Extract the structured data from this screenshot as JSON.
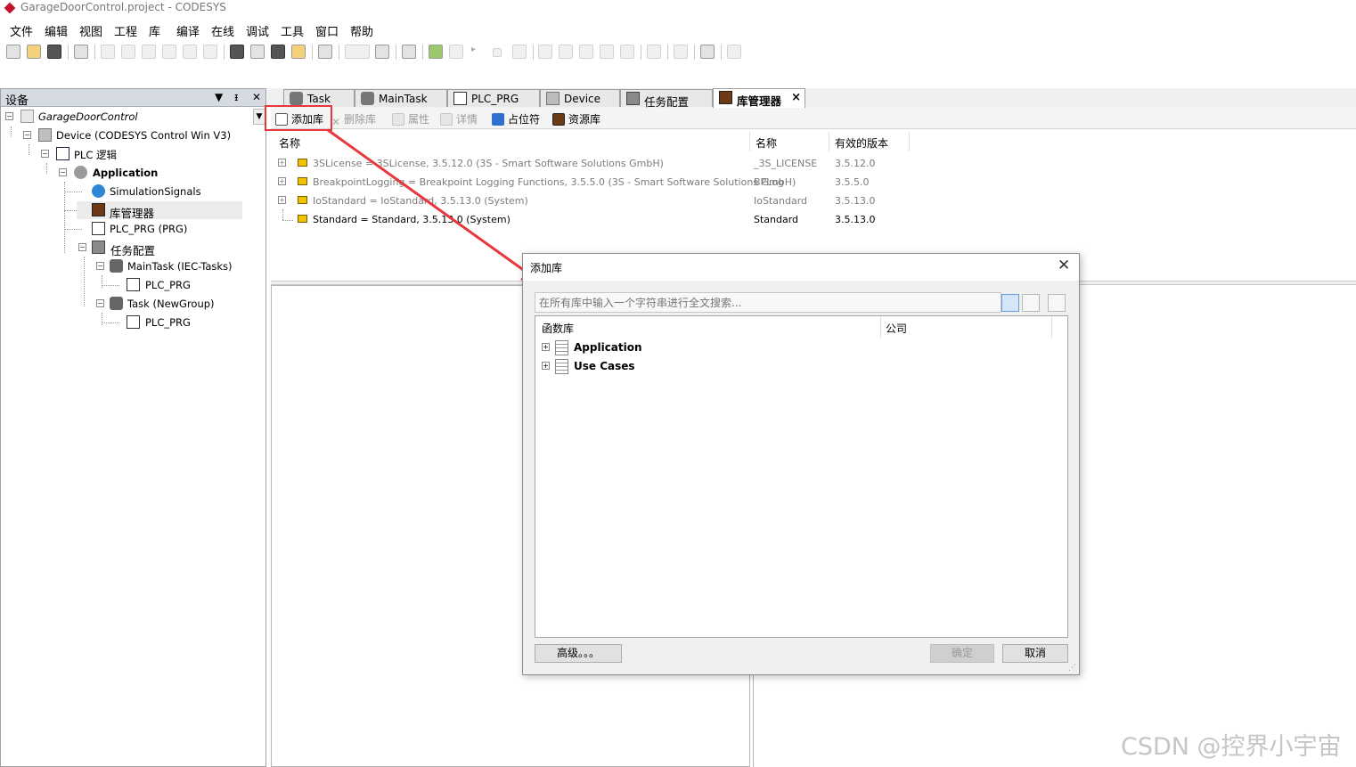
{
  "window": {
    "title": "GarageDoorControl.project - CODESYS"
  },
  "menu": [
    "文件",
    "编辑",
    "视图",
    "工程",
    "库",
    "编译",
    "在线",
    "调试",
    "工具",
    "窗口",
    "帮助"
  ],
  "toolbar_icons": [
    "new-file-icon",
    "open-icon",
    "save-icon",
    "print-icon",
    "undo-icon",
    "redo-icon",
    "cut-icon",
    "copy-icon",
    "paste-icon",
    "delete-icon",
    "find-icon",
    "find-replace-icon",
    "find-next-icon",
    "bookmark-icon",
    "window-icon",
    "dropdown-icon",
    "page-icon",
    "grid-icon",
    "build-icon",
    "build-all-icon",
    "run-icon",
    "stop-icon",
    "reset-icon",
    "step-into-icon",
    "step-over-icon",
    "step-out-icon",
    "breakpoint-icon",
    "gear-step-icon",
    "arrow-icon",
    "display-icon",
    "filter-icon",
    "check-icon"
  ],
  "devices_panel": {
    "title": "设备",
    "tree": [
      {
        "label": "GarageDoorControl",
        "italic": true
      },
      {
        "label": "Device (CODESYS Control Win V3)"
      },
      {
        "label": "PLC 逻辑"
      },
      {
        "label": "Application",
        "bold": true
      },
      {
        "label": "SimulationSignals"
      },
      {
        "label": "库管理器"
      },
      {
        "label": "PLC_PRG (PRG)"
      },
      {
        "label": "任务配置"
      },
      {
        "label": "MainTask (IEC-Tasks)"
      },
      {
        "label": "PLC_PRG"
      },
      {
        "label": "Task (NewGroup)"
      },
      {
        "label": "PLC_PRG"
      }
    ]
  },
  "tabs": [
    {
      "label": "Task"
    },
    {
      "label": "MainTask"
    },
    {
      "label": "PLC_PRG"
    },
    {
      "label": "Device"
    },
    {
      "label": "任务配置"
    },
    {
      "label": "库管理器",
      "active": true
    }
  ],
  "lib_toolbar": {
    "add": "添加库",
    "remove": "删除库",
    "properties": "属性",
    "details": "详情",
    "placeholder": "占位符",
    "repository": "资源库"
  },
  "lib_table": {
    "headers": [
      "名称",
      "名称",
      "有效的版本"
    ],
    "rows": [
      {
        "name": "3SLicense = 3SLicense, 3.5.12.0 (3S - Smart Software Solutions GmbH)",
        "ns": "_3S_LICENSE",
        "version": "3.5.12.0",
        "grey": true,
        "expand": true
      },
      {
        "name": "BreakpointLogging = Breakpoint Logging Functions, 3.5.5.0 (3S - Smart Software Solutions GmbH)",
        "ns": "BPLog",
        "version": "3.5.5.0",
        "grey": true,
        "expand": true
      },
      {
        "name": "IoStandard = IoStandard, 3.5.13.0 (System)",
        "ns": "IoStandard",
        "version": "3.5.13.0",
        "grey": true,
        "expand": true
      },
      {
        "name": "Standard = Standard, 3.5.13.0 (System)",
        "ns": "Standard",
        "version": "3.5.13.0",
        "grey": false,
        "expand": false
      }
    ]
  },
  "dialog": {
    "title": "添加库",
    "search_placeholder": "在所有库中输入一个字符串进行全文搜索...",
    "columns": [
      "函数库",
      "公司"
    ],
    "items": [
      "Application",
      "Use Cases"
    ],
    "advanced": "高级。。。",
    "ok": "确定",
    "cancel": "取消"
  },
  "watermark": "CSDN @控界小宇宙",
  "colors": {
    "annotation": "#e8383d",
    "panel_header": "#d6dbe2"
  }
}
